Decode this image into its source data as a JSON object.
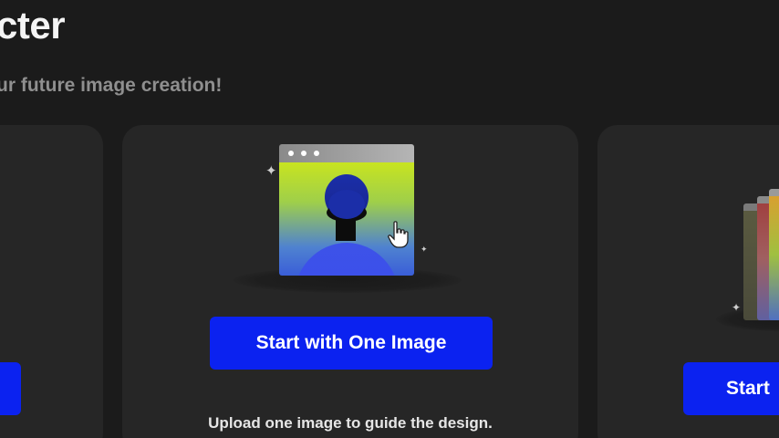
{
  "header": {
    "title": "cter",
    "subtitle": "ur future image creation!"
  },
  "cards": {
    "left": {
      "button_label": ""
    },
    "center": {
      "button_label": "Start with One Image",
      "description": "Upload one image to guide the design."
    },
    "right": {
      "button_label": "Start"
    }
  },
  "colors": {
    "background": "#1b1b1b",
    "card": "#262626",
    "accent_button": "#0b22f0",
    "title_text": "#f4f4f4",
    "subtitle_text": "#8f8f8f"
  },
  "icons": {
    "center_illustration": "portrait-window-icon",
    "cursor": "hand-pointer-icon",
    "sparkle": "sparkle-icon",
    "right_illustration": "stacked-images-icon"
  }
}
